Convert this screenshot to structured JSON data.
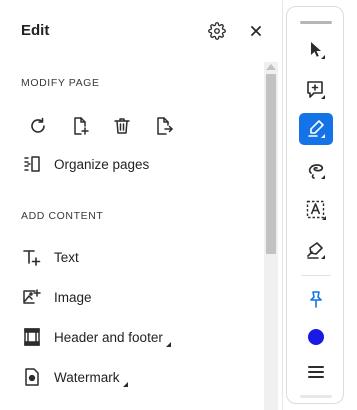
{
  "panel": {
    "title": "Edit",
    "modify_page": {
      "heading": "MODIFY PAGE",
      "buttons": [
        "rotate-icon",
        "insert-page-icon",
        "delete-icon",
        "extract-page-icon"
      ],
      "organize_label": "Organize pages"
    },
    "add_content": {
      "heading": "ADD CONTENT",
      "items": [
        {
          "label": "Text",
          "icon": "add-text-icon",
          "has_menu": false
        },
        {
          "label": "Image",
          "icon": "add-image-icon",
          "has_menu": false
        },
        {
          "label": "Header and footer",
          "icon": "header-footer-icon",
          "has_menu": true
        },
        {
          "label": "Watermark",
          "icon": "watermark-icon",
          "has_menu": true
        }
      ]
    }
  },
  "toolbar": {
    "tools": [
      "select-icon",
      "add-comment-icon",
      "highlight-icon",
      "draw-freeform-icon",
      "text-select-icon",
      "sign-icon",
      "pin-icon",
      "color-picker-icon",
      "more-menu-icon"
    ],
    "active_tool": "highlight-icon",
    "current_color": "#1a1ae6",
    "accent": "#1473e6"
  }
}
